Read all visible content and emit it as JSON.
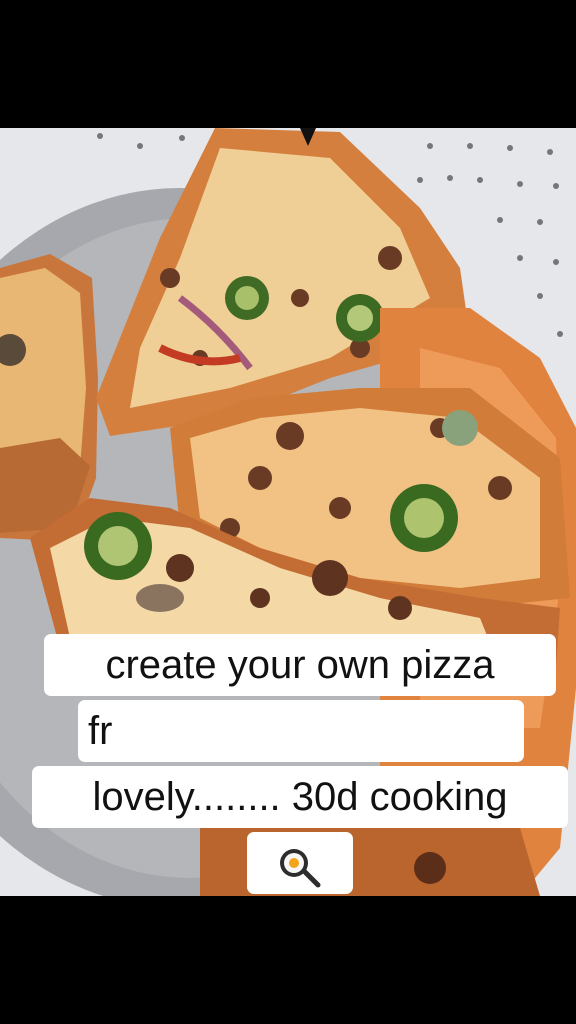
{
  "caption": {
    "line1": "create your own pizza",
    "line2": "fr",
    "line3": "lovely........ 30d cooking",
    "line4_icon": "frying-pan-egg-icon"
  },
  "photo": {
    "subject": "pizza on a perforated tray",
    "accent": "#d9823a"
  }
}
